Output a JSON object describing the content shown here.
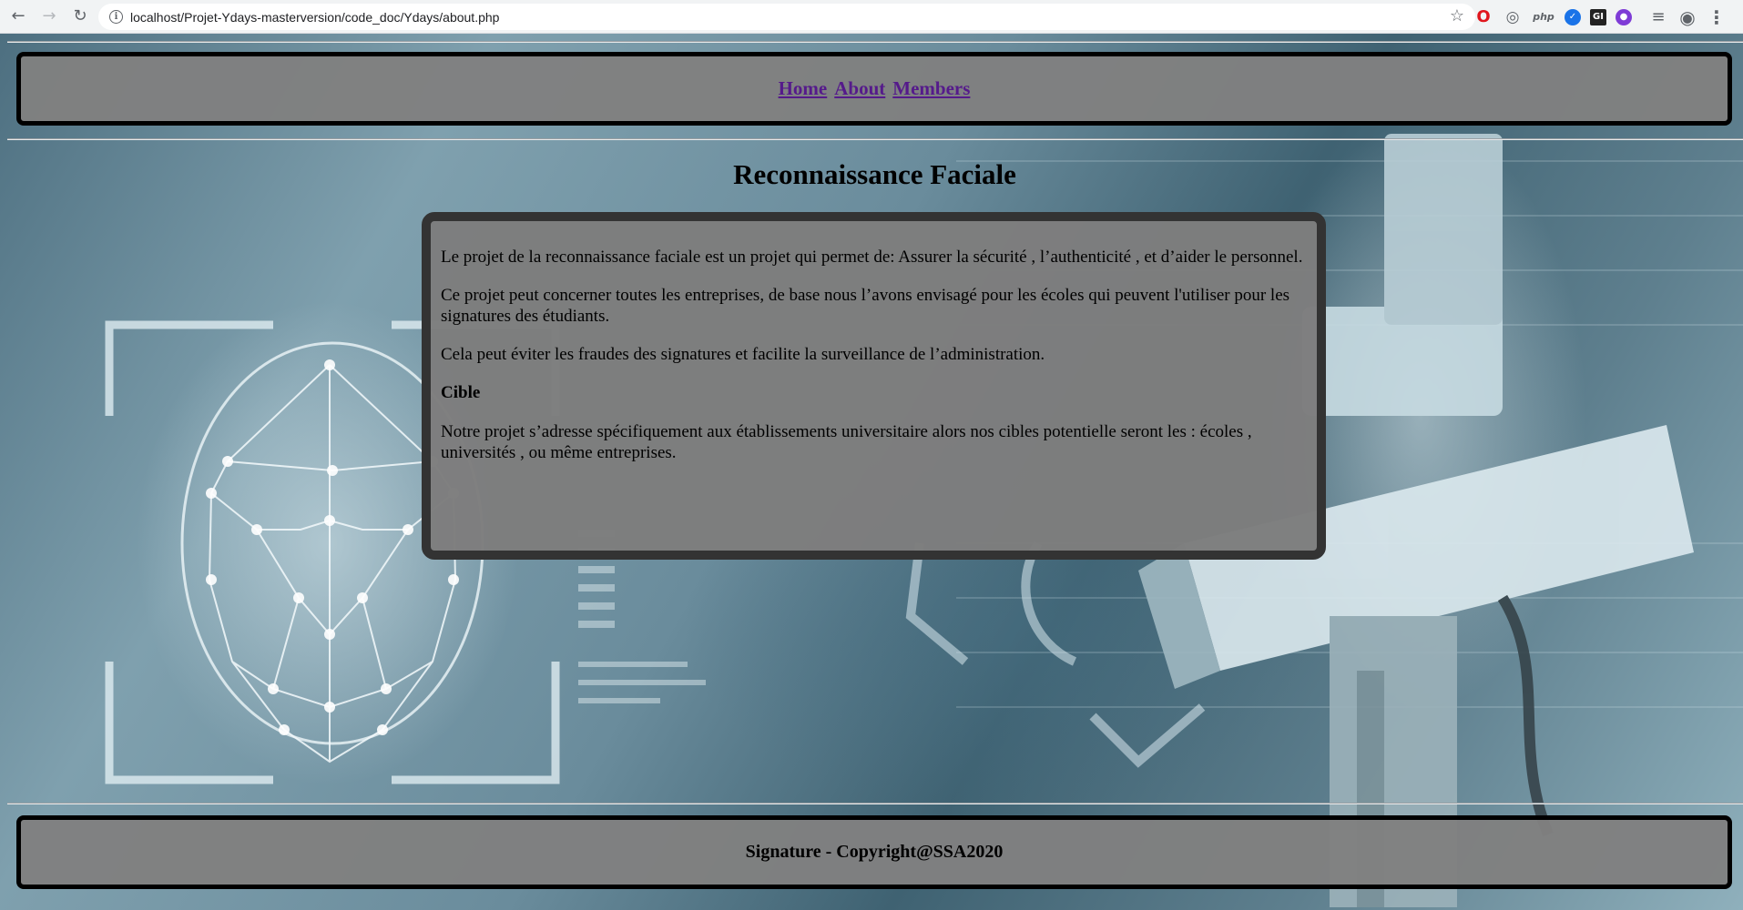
{
  "browser": {
    "url": "localhost/Projet-Ydays-masterversion/code_doc/Ydays/about.php",
    "back_icon": "←",
    "forward_icon": "→",
    "reload_icon": "↻",
    "info_icon": "i",
    "star_icon": "☆",
    "extensions": {
      "opera": "O",
      "globe": "◎",
      "php": "php",
      "messenger": "✓",
      "gl": "GI",
      "purple": "●",
      "queue": "≡",
      "profile": "◉",
      "menu": "⋮"
    }
  },
  "nav": {
    "links": [
      "Home",
      "About",
      "Members"
    ]
  },
  "main": {
    "title": "Reconnaissance Faciale",
    "paragraphs": [
      "Le projet de la reconnaissance faciale est un projet qui permet de: Assurer la sécurité , l’authenticité , et d’aider le personnel.",
      "Ce projet peut concerner toutes les entreprises, de base nous l’avons envisagé pour les écoles qui peuvent l'utiliser pour les signatures des étudiants.",
      "Cela peut éviter les fraudes des signatures et facilite la surveillance de l’administration."
    ],
    "subheading": "Cible",
    "target_paragraph": "Notre projet s’adresse spécifiquement aux établissements universitaire alors nos cibles potentielle seront les : écoles , universités , ou même entreprises."
  },
  "footer": {
    "text": "Signature - Copyright@SSA2020"
  }
}
